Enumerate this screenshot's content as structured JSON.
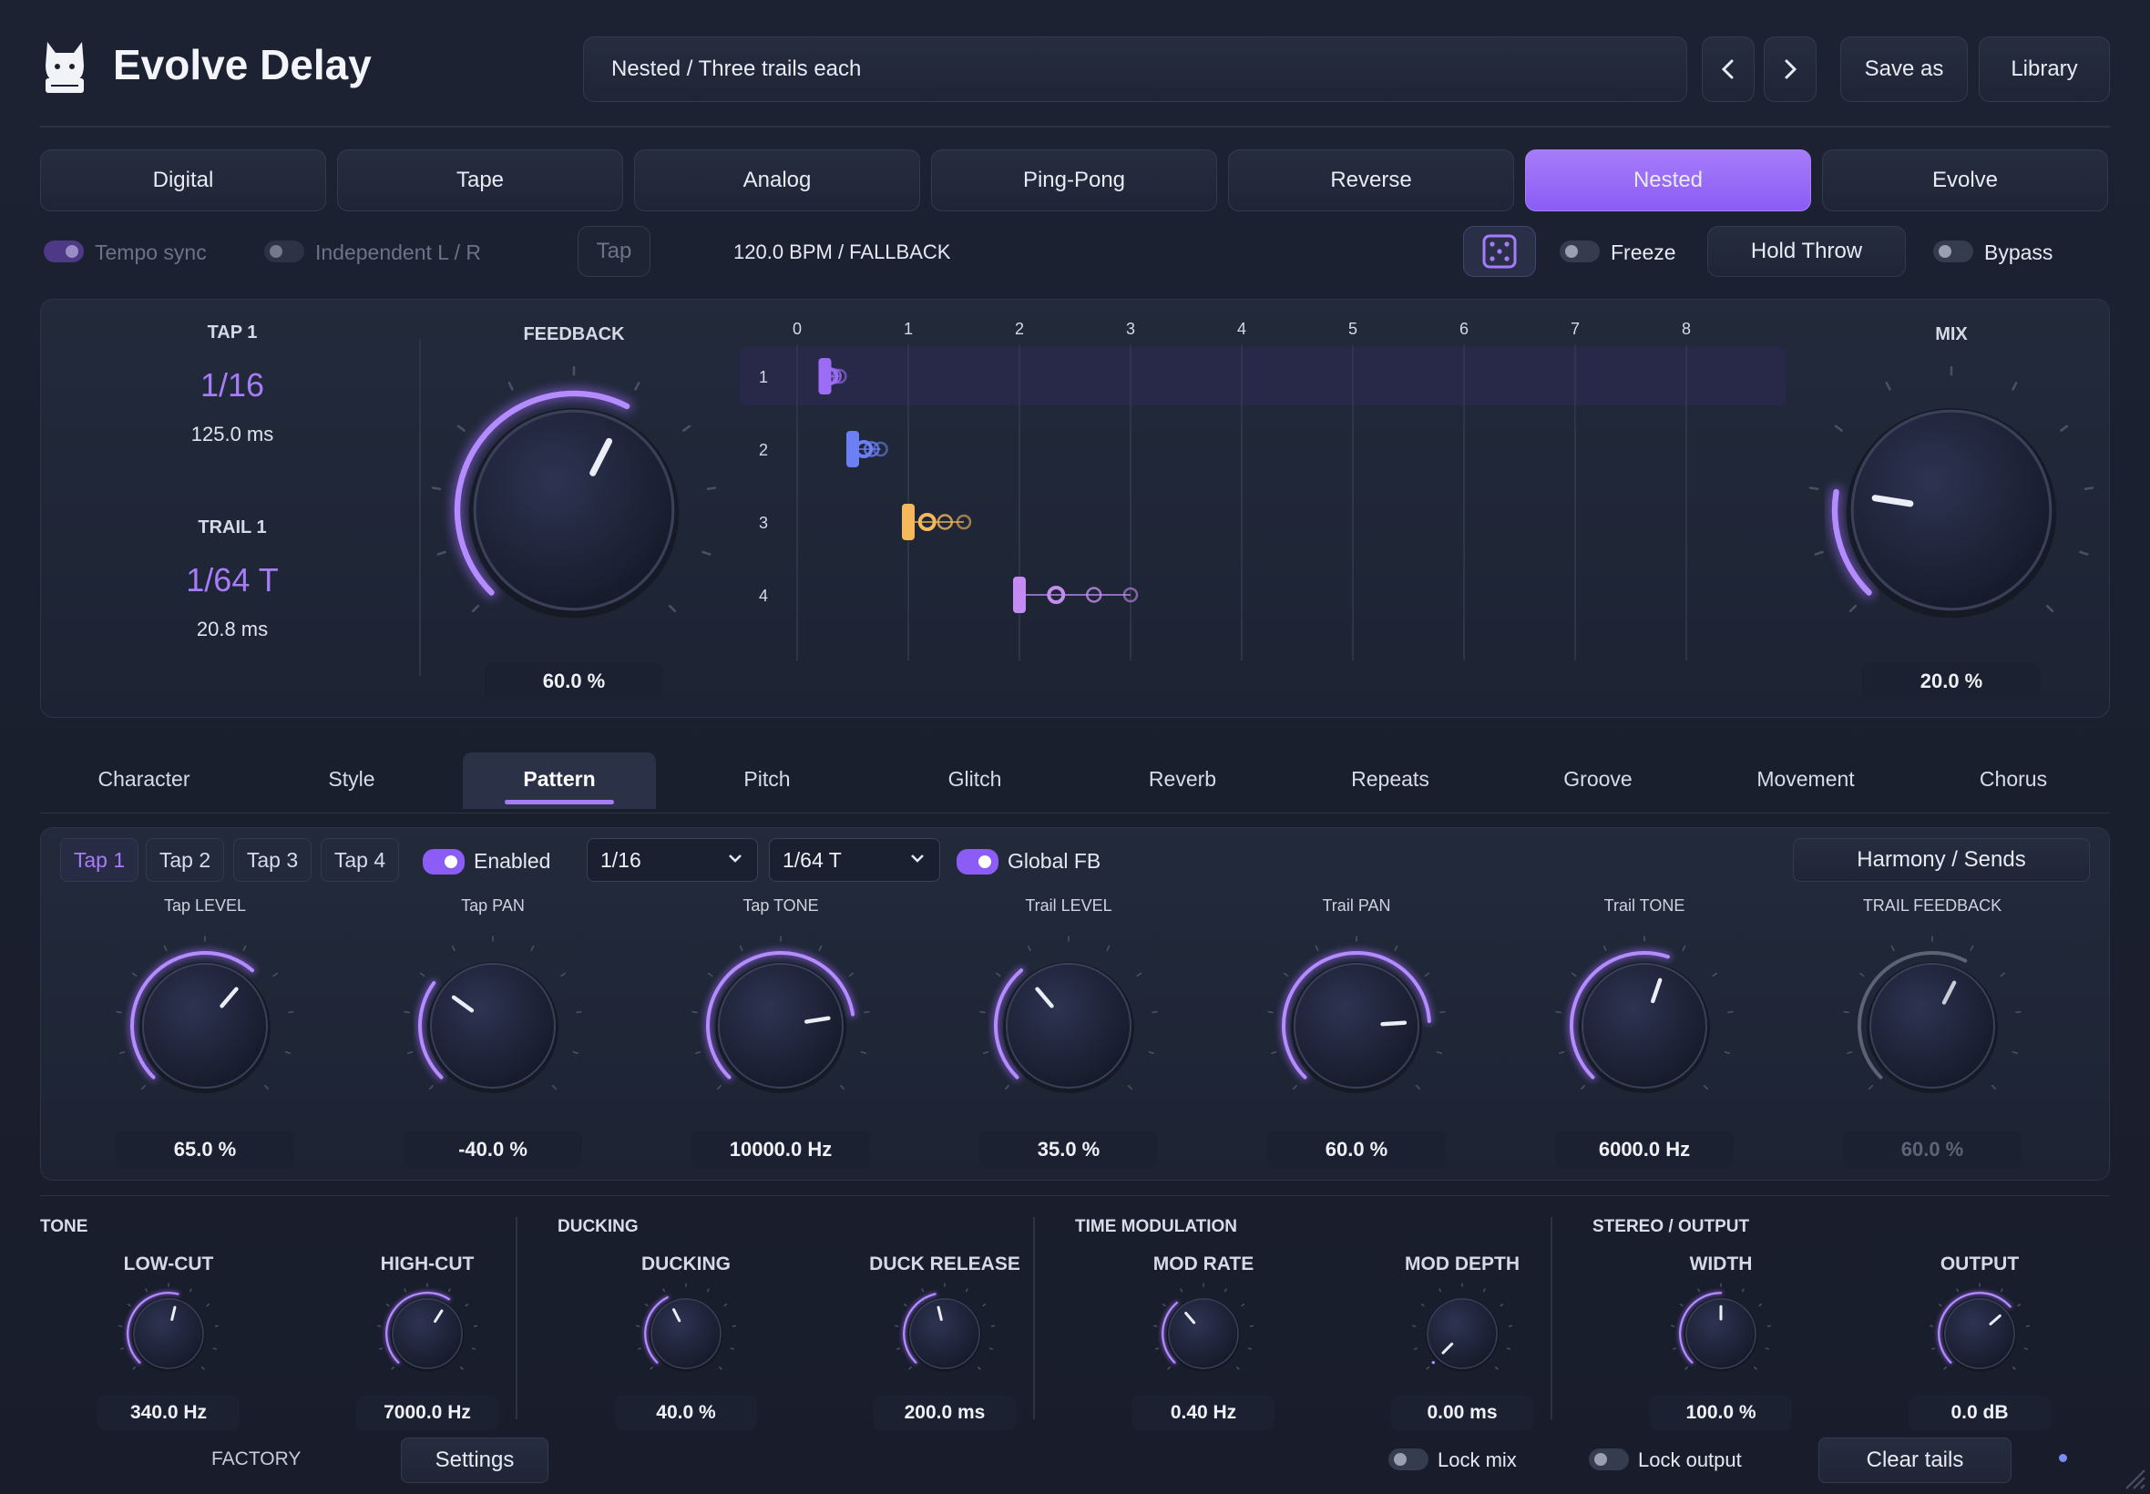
{
  "app": {
    "title": "Evolve Delay"
  },
  "header": {
    "preset": "Nested / Three trails each",
    "save_as": "Save as",
    "library": "Library",
    "prev_icon": "chevron-left-icon",
    "next_icon": "chevron-right-icon"
  },
  "modes": [
    {
      "label": "Digital",
      "active": false
    },
    {
      "label": "Tape",
      "active": false
    },
    {
      "label": "Analog",
      "active": false
    },
    {
      "label": "Ping-Pong",
      "active": false
    },
    {
      "label": "Reverse",
      "active": false
    },
    {
      "label": "Nested",
      "active": true
    },
    {
      "label": "Evolve",
      "active": false
    }
  ],
  "controls": {
    "tempo_sync": "Tempo sync",
    "independent": "Independent L / R",
    "tap": "Tap",
    "bpm": "120.0 BPM / FALLBACK",
    "freeze": "Freeze",
    "hold_throw": "Hold Throw",
    "bypass": "Bypass"
  },
  "main": {
    "tap1_label": "TAP 1",
    "tap1_value": "1/16",
    "tap1_ms": "125.0 ms",
    "trail1_label": "TRAIL 1",
    "trail1_value": "1/64 T",
    "trail1_ms": "20.8 ms",
    "feedback_label": "FEEDBACK",
    "feedback_value": "60.0 %",
    "feedback_level": 0.6,
    "mix_label": "MIX",
    "mix_value": "20.0 %",
    "mix_level": 0.2
  },
  "chart_data": {
    "type": "scatter",
    "x_ticks": [
      "0",
      "1",
      "2",
      "3",
      "4",
      "5",
      "6",
      "7",
      "8"
    ],
    "row_labels": [
      "1",
      "2",
      "3",
      "4"
    ],
    "xlim": [
      0,
      8
    ],
    "rows": [
      {
        "row": 1,
        "tap": 0.25,
        "trails": [
          0.29,
          0.33,
          0.38
        ],
        "color": "#9b6cf5"
      },
      {
        "row": 2,
        "tap": 0.5,
        "trails": [
          0.6,
          0.67,
          0.75
        ],
        "color": "#6d7ff5"
      },
      {
        "row": 3,
        "tap": 1.0,
        "trails": [
          1.17,
          1.33,
          1.5
        ],
        "color": "#f5b95c"
      },
      {
        "row": 4,
        "tap": 2.0,
        "trails": [
          2.33,
          2.67,
          3.0
        ],
        "color": "#c48cf2"
      }
    ]
  },
  "subtabs": [
    {
      "label": "Character",
      "active": false
    },
    {
      "label": "Style",
      "active": false
    },
    {
      "label": "Pattern",
      "active": true
    },
    {
      "label": "Pitch",
      "active": false
    },
    {
      "label": "Glitch",
      "active": false
    },
    {
      "label": "Reverb",
      "active": false
    },
    {
      "label": "Repeats",
      "active": false
    },
    {
      "label": "Groove",
      "active": false
    },
    {
      "label": "Movement",
      "active": false
    },
    {
      "label": "Chorus",
      "active": false
    }
  ],
  "pattern": {
    "taps": [
      "Tap 1",
      "Tap 2",
      "Tap 3",
      "Tap 4"
    ],
    "enabled": "Enabled",
    "sel1": "1/16",
    "sel2": "1/64 T",
    "global_fb": "Global FB",
    "harmony": "Harmony / Sends",
    "knobs": [
      {
        "label": "Tap LEVEL",
        "value": "65.0 %",
        "level": 0.65,
        "dim": false
      },
      {
        "label": "Tap PAN",
        "value": "-40.0 %",
        "level": 0.3,
        "dim": false
      },
      {
        "label": "Tap TONE",
        "value": "10000.0 Hz",
        "level": 0.8,
        "dim": false
      },
      {
        "label": "Trail LEVEL",
        "value": "35.0 %",
        "level": 0.35,
        "dim": false
      },
      {
        "label": "Trail PAN",
        "value": "60.0 %",
        "level": 0.82,
        "dim": false
      },
      {
        "label": "Trail TONE",
        "value": "6000.0 Hz",
        "level": 0.57,
        "dim": false
      },
      {
        "label": "TRAIL FEEDBACK",
        "value": "60.0 %",
        "level": 0.6,
        "dim": true
      }
    ]
  },
  "sections": [
    {
      "title": "TONE",
      "knobs": [
        {
          "label": "LOW-CUT",
          "value": "340.0 Hz",
          "level": 0.55
        },
        {
          "label": "HIGH-CUT",
          "value": "7000.0 Hz",
          "level": 0.62
        }
      ]
    },
    {
      "title": "DUCKING",
      "knobs": [
        {
          "label": "DUCKING",
          "value": "40.0 %",
          "level": 0.4
        },
        {
          "label": "DUCK RELEASE",
          "value": "200.0 ms",
          "level": 0.45
        }
      ]
    },
    {
      "title": "TIME MODULATION",
      "knobs": [
        {
          "label": "MOD RATE",
          "value": "0.40 Hz",
          "level": 0.35
        },
        {
          "label": "MOD DEPTH",
          "value": "0.00 ms",
          "level": 0.0
        }
      ]
    },
    {
      "title": "STEREO / OUTPUT",
      "knobs": [
        {
          "label": "WIDTH",
          "value": "100.0 %",
          "level": 0.5
        },
        {
          "label": "OUTPUT",
          "value": "0.0 dB",
          "level": 0.68
        }
      ]
    }
  ],
  "footer": {
    "factory": "FACTORY",
    "settings": "Settings",
    "lock_mix": "Lock mix",
    "lock_output": "Lock output",
    "clear_tails": "Clear tails"
  },
  "colors": {
    "accent": "#8b5cf6",
    "accent_light": "#b48cff",
    "bg": "#1b2030"
  }
}
